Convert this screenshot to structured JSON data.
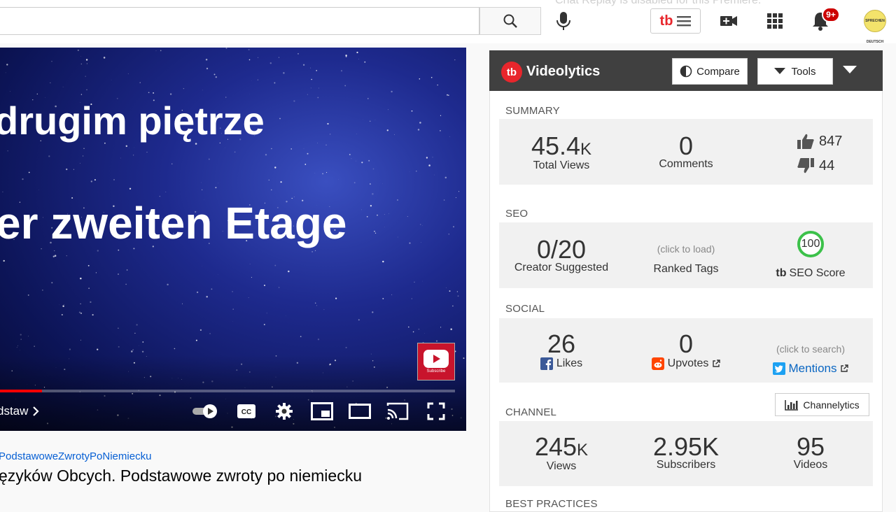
{
  "topbar": {
    "faded_title": "Chat Replay is disabled for this Premiere.",
    "notifications_badge": "9+",
    "avatar_text": "SPRECHEN DEUTSCH"
  },
  "video": {
    "subtitle_line1": "drugim piętrze",
    "subtitle_line2": "er zweiten Etage",
    "watermark_text": "Subscribe",
    "chapter_label": "dstaw",
    "progress_fraction": 0.092,
    "hashtag": "PodstawoweZwrotyPoNiemiecku",
    "title": "ęzyków Obcych. Podstawowe zwroty po niemiecku"
  },
  "videolytics": {
    "logo_text": "tb",
    "title": "Videolytics",
    "compare_label": "Compare",
    "tools_label": "Tools",
    "summary": {
      "label": "SUMMARY",
      "views_value": "45.4",
      "views_unit": "K",
      "views_label": "Total Views",
      "comments_value": "0",
      "comments_label": "Comments",
      "likes": "847",
      "dislikes": "44"
    },
    "seo": {
      "label": "SEO",
      "creator_value": "0/20",
      "creator_label": "Creator Suggested",
      "ranked_hint": "(click to load)",
      "ranked_label": "Ranked Tags",
      "score_value": "100",
      "score_label": "SEO Score"
    },
    "social": {
      "label": "SOCIAL",
      "likes_value": "26",
      "likes_label": "Likes",
      "upvotes_value": "0",
      "upvotes_label": "Upvotes",
      "mentions_hint": "(click to search)",
      "mentions_label": "Mentions"
    },
    "channel": {
      "label": "CHANNEL",
      "channelytics_label": "Channelytics",
      "views_value": "245",
      "views_unit": "K",
      "views_label": "Views",
      "subs_value": "2.95K",
      "subs_label": "Subscribers",
      "videos_value": "95",
      "videos_label": "Videos"
    },
    "best_practices_label": "BEST PRACTICES"
  },
  "colors": {
    "brand_red": "#e8262c",
    "header_dark": "#404040",
    "seo_green": "#3cc14a",
    "link_blue": "#0a66c2",
    "facebook": "#3b5998",
    "reddit": "#ff4500",
    "twitter": "#1da1f2"
  }
}
